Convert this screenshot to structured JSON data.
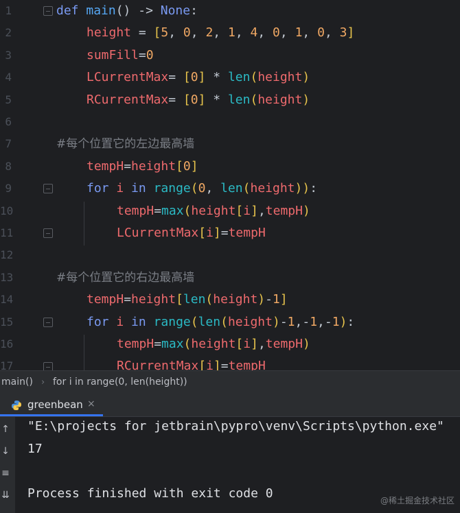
{
  "editor": {
    "lines": [
      {
        "n": "1",
        "tokens": [
          [
            "k",
            "def "
          ],
          [
            "fn",
            "main"
          ],
          [
            "op",
            "() -> "
          ],
          [
            "k",
            "None"
          ],
          [
            "op",
            ":"
          ]
        ]
      },
      {
        "n": "2",
        "tokens": [
          [
            "var",
            "height"
          ],
          [
            "op",
            " = "
          ],
          [
            "bk",
            "["
          ],
          [
            "num",
            "5"
          ],
          [
            "op",
            ", "
          ],
          [
            "num",
            "0"
          ],
          [
            "op",
            ", "
          ],
          [
            "num",
            "2"
          ],
          [
            "op",
            ", "
          ],
          [
            "num",
            "1"
          ],
          [
            "op",
            ", "
          ],
          [
            "num",
            "4"
          ],
          [
            "op",
            ", "
          ],
          [
            "num",
            "0"
          ],
          [
            "op",
            ", "
          ],
          [
            "num",
            "1"
          ],
          [
            "op",
            ", "
          ],
          [
            "num",
            "0"
          ],
          [
            "op",
            ", "
          ],
          [
            "num",
            "3"
          ],
          [
            "bk",
            "]"
          ]
        ]
      },
      {
        "n": "3",
        "tokens": [
          [
            "var",
            "sumFill"
          ],
          [
            "op",
            "="
          ],
          [
            "num",
            "0"
          ]
        ]
      },
      {
        "n": "4",
        "tokens": [
          [
            "var",
            "LCurrentMax"
          ],
          [
            "op",
            "= "
          ],
          [
            "bk",
            "["
          ],
          [
            "num",
            "0"
          ],
          [
            "bk",
            "]"
          ],
          [
            "op",
            " * "
          ],
          [
            "bi",
            "len"
          ],
          [
            "bk",
            "("
          ],
          [
            "var",
            "height"
          ],
          [
            "bk",
            ")"
          ]
        ]
      },
      {
        "n": "5",
        "tokens": [
          [
            "var",
            "RCurrentMax"
          ],
          [
            "op",
            "= "
          ],
          [
            "bk",
            "["
          ],
          [
            "num",
            "0"
          ],
          [
            "bk",
            "]"
          ],
          [
            "op",
            " * "
          ],
          [
            "bi",
            "len"
          ],
          [
            "bk",
            "("
          ],
          [
            "var",
            "height"
          ],
          [
            "bk",
            ")"
          ]
        ]
      },
      {
        "n": "6",
        "tokens": []
      },
      {
        "n": "7",
        "tokens": [
          [
            "cm",
            "#每个位置它的左边最高墙"
          ]
        ]
      },
      {
        "n": "8",
        "tokens": [
          [
            "var",
            "tempH"
          ],
          [
            "op",
            "="
          ],
          [
            "var",
            "height"
          ],
          [
            "bk",
            "["
          ],
          [
            "num",
            "0"
          ],
          [
            "bk",
            "]"
          ]
        ]
      },
      {
        "n": "9",
        "tokens": [
          [
            "k",
            "for "
          ],
          [
            "var",
            "i"
          ],
          [
            "k",
            " in "
          ],
          [
            "bi",
            "range"
          ],
          [
            "bk",
            "("
          ],
          [
            "num",
            "0"
          ],
          [
            "op",
            ", "
          ],
          [
            "bi",
            "len"
          ],
          [
            "bk",
            "("
          ],
          [
            "var",
            "height"
          ],
          [
            "bk",
            "))"
          ],
          [
            "op",
            ":"
          ]
        ]
      },
      {
        "n": "10",
        "tokens": [
          [
            "var",
            "tempH"
          ],
          [
            "op",
            "="
          ],
          [
            "bi",
            "max"
          ],
          [
            "bk",
            "("
          ],
          [
            "var",
            "height"
          ],
          [
            "bk",
            "["
          ],
          [
            "var",
            "i"
          ],
          [
            "bk",
            "]"
          ],
          [
            "op",
            ","
          ],
          [
            "var",
            "tempH"
          ],
          [
            "bk",
            ")"
          ]
        ]
      },
      {
        "n": "11",
        "tokens": [
          [
            "var",
            "LCurrentMax"
          ],
          [
            "bk",
            "["
          ],
          [
            "var",
            "i"
          ],
          [
            "bk",
            "]"
          ],
          [
            "op",
            "="
          ],
          [
            "var",
            "tempH"
          ]
        ]
      },
      {
        "n": "12",
        "tokens": []
      },
      {
        "n": "13",
        "tokens": [
          [
            "cm",
            "#每个位置它的右边最高墙"
          ]
        ]
      },
      {
        "n": "14",
        "tokens": [
          [
            "var",
            "tempH"
          ],
          [
            "op",
            "="
          ],
          [
            "var",
            "height"
          ],
          [
            "bk",
            "["
          ],
          [
            "bi",
            "len"
          ],
          [
            "bk",
            "("
          ],
          [
            "var",
            "height"
          ],
          [
            "bk",
            ")"
          ],
          [
            "op",
            "-"
          ],
          [
            "num",
            "1"
          ],
          [
            "bk",
            "]"
          ]
        ]
      },
      {
        "n": "15",
        "tokens": [
          [
            "k",
            "for "
          ],
          [
            "var",
            "i"
          ],
          [
            "k",
            " in "
          ],
          [
            "bi",
            "range"
          ],
          [
            "bk",
            "("
          ],
          [
            "bi",
            "len"
          ],
          [
            "bk",
            "("
          ],
          [
            "var",
            "height"
          ],
          [
            "bk",
            ")"
          ],
          [
            "op",
            "-"
          ],
          [
            "num",
            "1"
          ],
          [
            "op",
            ",-"
          ],
          [
            "num",
            "1"
          ],
          [
            "op",
            ",-"
          ],
          [
            "num",
            "1"
          ],
          [
            "bk",
            ")"
          ],
          [
            "op",
            ":"
          ]
        ]
      },
      {
        "n": "16",
        "tokens": [
          [
            "var",
            "tempH"
          ],
          [
            "op",
            "="
          ],
          [
            "bi",
            "max"
          ],
          [
            "bk",
            "("
          ],
          [
            "var",
            "height"
          ],
          [
            "bk",
            "["
          ],
          [
            "var",
            "i"
          ],
          [
            "bk",
            "]"
          ],
          [
            "op",
            ","
          ],
          [
            "var",
            "tempH"
          ],
          [
            "bk",
            ")"
          ]
        ]
      },
      {
        "n": "17",
        "tokens": [
          [
            "var",
            "RCurrentMax"
          ],
          [
            "bk",
            "["
          ],
          [
            "var",
            "i"
          ],
          [
            "bk",
            "]"
          ],
          [
            "op",
            "="
          ],
          [
            "var",
            "tempH"
          ]
        ]
      }
    ]
  },
  "breadcrumb": {
    "items": [
      "main()",
      "for i in range(0, len(height))"
    ]
  },
  "run": {
    "tab_label": "greenbean",
    "close_icon": "×",
    "output": [
      "\"E:\\projects for jetbrain\\pypro\\venv\\Scripts\\python.exe\"",
      "17",
      "",
      "Process finished with exit code 0"
    ]
  },
  "watermark": "@稀土掘金技术社区",
  "colors": {
    "editor_bg": "#1e1f22",
    "keyword": "#7a9af2",
    "variable": "#ee6a6d",
    "number": "#f0a864",
    "builtin": "#2bbac5",
    "comment": "#7a7e85",
    "tab_underline": "#3574f0"
  }
}
